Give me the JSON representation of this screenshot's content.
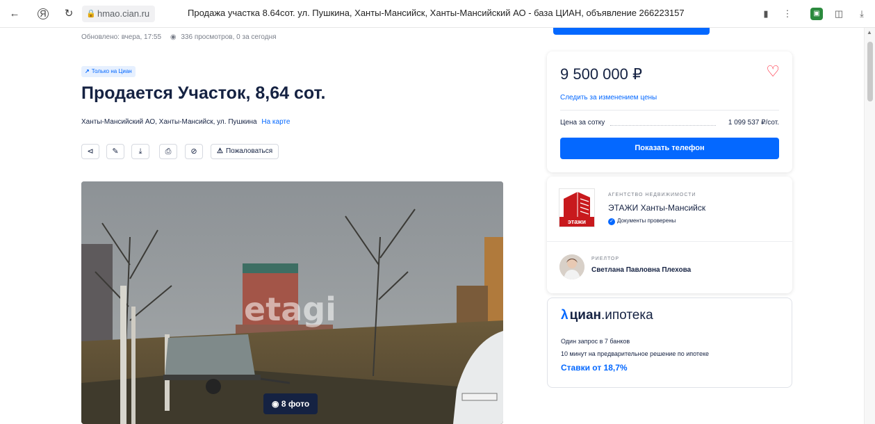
{
  "browser": {
    "domain": "hmao.cian.ru",
    "tab_title": "Продажа участка 8.64сот. ул. Пушкина, Ханты-Мансийск, Ханты-Мансийский АО - база ЦИАН, объявление 266223157",
    "icons": [
      "back-arrow-icon",
      "yandex-icon",
      "reload-icon",
      "lock-icon",
      "bookmark-icon",
      "menu-dots-icon",
      "extension-icon",
      "reader-icon",
      "download-icon"
    ]
  },
  "listing": {
    "updated": "Обновлено: вчера, 17:55",
    "views": "336 просмотров, 0 за сегодня",
    "only_badge": "Только на Циан",
    "title": "Продается Участок, 8,64 сот.",
    "address": "Ханты-Мансийский АО, Ханты-Мансийск, ул. Пушкина",
    "map_link": "На карте",
    "complain_label": "Пожаловаться",
    "photo_watermark": "etagi",
    "photo_count": "8 фото"
  },
  "price_card": {
    "price": "9 500 000 ₽",
    "follow_price": "Следить за изменением цены",
    "per_sotka_label": "Цена за сотку",
    "per_sotka_value": "1 099 537 ₽/сот.",
    "phone_button": "Показать телефон"
  },
  "agent": {
    "agency_type": "АГЕНТСТВО НЕДВИЖИМОСТИ",
    "agency_name": "ЭТАЖИ Ханты-Мансийск",
    "verified": "Документы проверены",
    "logo_text": "этажи",
    "realtor_label": "РИЕЛТОР",
    "realtor_name": "Светлана Павловна Плехова"
  },
  "mortgage": {
    "brand_main": "циан",
    "brand_suffix": ".ипотека",
    "line1": "Один запрос в 7 банков",
    "line2": "10 минут на предварительное решение по ипотеке",
    "rates": "Ставки от 18,7%"
  },
  "colors": {
    "accent": "#0468ff",
    "text": "#152242",
    "heart": "#ff1f34",
    "agency_red": "#c8191d"
  }
}
